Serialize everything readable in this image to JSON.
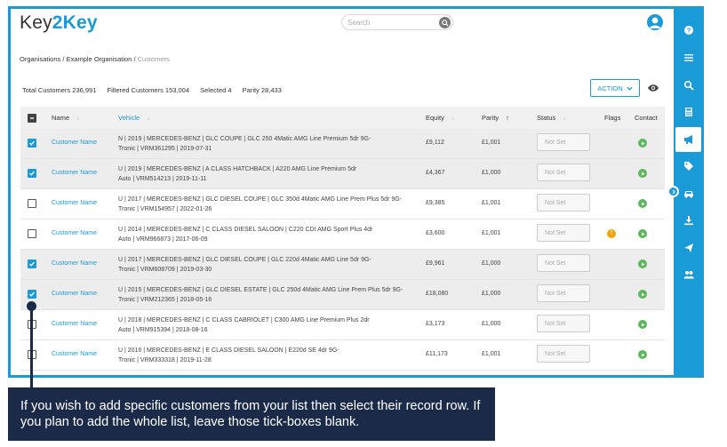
{
  "header": {
    "logo_part1": "Key",
    "logo_part2": "2Key",
    "search_placeholder": "Search"
  },
  "breadcrumb": {
    "items": [
      "Organisations",
      "Example Organisation",
      "Customers"
    ],
    "separator": "/"
  },
  "stats": {
    "total": "Total Customers 236,991",
    "filtered": "Filtered Customers 153,004",
    "selected": "Selected 4",
    "parity": "Parity 28,433"
  },
  "toolbar": {
    "action_label": "ACTION"
  },
  "table": {
    "headers": {
      "name": "Name",
      "vehicle": "Vehicle",
      "equity": "Equity",
      "parity": "Parity",
      "status": "Status",
      "flags": "Flags",
      "contact": "Contact"
    },
    "rows": [
      {
        "selected": true,
        "name": "Customer Name",
        "vehicle_line1": "N | 2019 | MERCEDES-BENZ | GLC COUPE | GLC 250 4Matic AMG Line Premium 5dr 9G-",
        "vehicle_line2": "Tronic | VRM361295 | 2019-07-31",
        "equity": "£9,112",
        "parity": "£1,001",
        "status": "Not Set",
        "flag": false
      },
      {
        "selected": true,
        "name": "Customer Name",
        "vehicle_line1": "U | 2019 | MERCEDES-BENZ | A CLASS HATCHBACK | A220 AMG Line Premium 5dr",
        "vehicle_line2": "Auto | VRM514213 | 2019-11-11",
        "equity": "£4,367",
        "parity": "£1,000",
        "status": "Not Set",
        "flag": false
      },
      {
        "selected": false,
        "name": "Customer Name",
        "vehicle_line1": "U | 2017 | MERCEDES-BENZ | GLC DIESEL COUPE | GLC 350d 4Matic AMG Line Prem Plus 5dr 9G-",
        "vehicle_line2": "Tronic | VRM154957 | 2022-01-26",
        "equity": "£9,385",
        "parity": "£1,001",
        "status": "Not Set",
        "flag": false
      },
      {
        "selected": false,
        "name": "Customer Name",
        "vehicle_line1": "U | 2014 | MERCEDES-BENZ | C CLASS DIESEL SALOON | C220 CDI AMG Sport Plus 4dr",
        "vehicle_line2": "Auto | VRM966873 | 2017-06-09",
        "equity": "£3,600",
        "parity": "£1,001",
        "status": "Not Set",
        "flag": true
      },
      {
        "selected": true,
        "name": "Customer Name",
        "vehicle_line1": "U | 2017 | MERCEDES-BENZ | GLC DIESEL COUPE | GLC 220d 4Matic AMG Line 5dr 9G-",
        "vehicle_line2": "Tronic | VRM608709 | 2019-03-30",
        "equity": "£9,961",
        "parity": "£1,000",
        "status": "Not Set",
        "flag": false
      },
      {
        "selected": true,
        "name": "Customer Name",
        "vehicle_line1": "U | 2015 | MERCEDES-BENZ | GLC DIESEL ESTATE | GLC 250d 4Matic AMG Line Prem Plus 5dr 9G-",
        "vehicle_line2": "Tronic | VRM212365 | 2018-05-16",
        "equity": "£18,080",
        "parity": "£1,000",
        "status": "Not Set",
        "flag": false
      },
      {
        "selected": false,
        "name": "Customer Name",
        "vehicle_line1": "U | 2018 | MERCEDES-BENZ | C CLASS CABRIOLET | C300 AMG Line Premium Plus 2dr",
        "vehicle_line2": "Auto | VRM915394 | 2018-08-16",
        "equity": "£3,173",
        "parity": "£1,000",
        "status": "Not Set",
        "flag": false
      },
      {
        "selected": false,
        "name": "Customer Name",
        "vehicle_line1": "U | 2016 | MERCEDES-BENZ | E CLASS DIESEL SALOON | E220d SE 4dr 9G-",
        "vehicle_line2": "Tronic | VRM333318 | 2019-11-28",
        "equity": "£11,173",
        "parity": "£1,001",
        "status": "Not Set",
        "flag": false
      }
    ]
  },
  "sidebar_icons": [
    "help-icon",
    "menu-icon",
    "search-icon",
    "calculator-icon",
    "megaphone-icon",
    "tag-icon",
    "car-icon",
    "download-icon",
    "send-icon",
    "users-icon"
  ],
  "callout": {
    "text": "If you wish to add specific customers from your list then select their record row.  If you plan to add the whole list, leave those tick-boxes blank."
  },
  "colors": {
    "accent": "#1a9ad6",
    "callout_bg": "#1c2a4a",
    "contact_green": "#5cb85c",
    "flag_orange": "#f0a30a"
  }
}
